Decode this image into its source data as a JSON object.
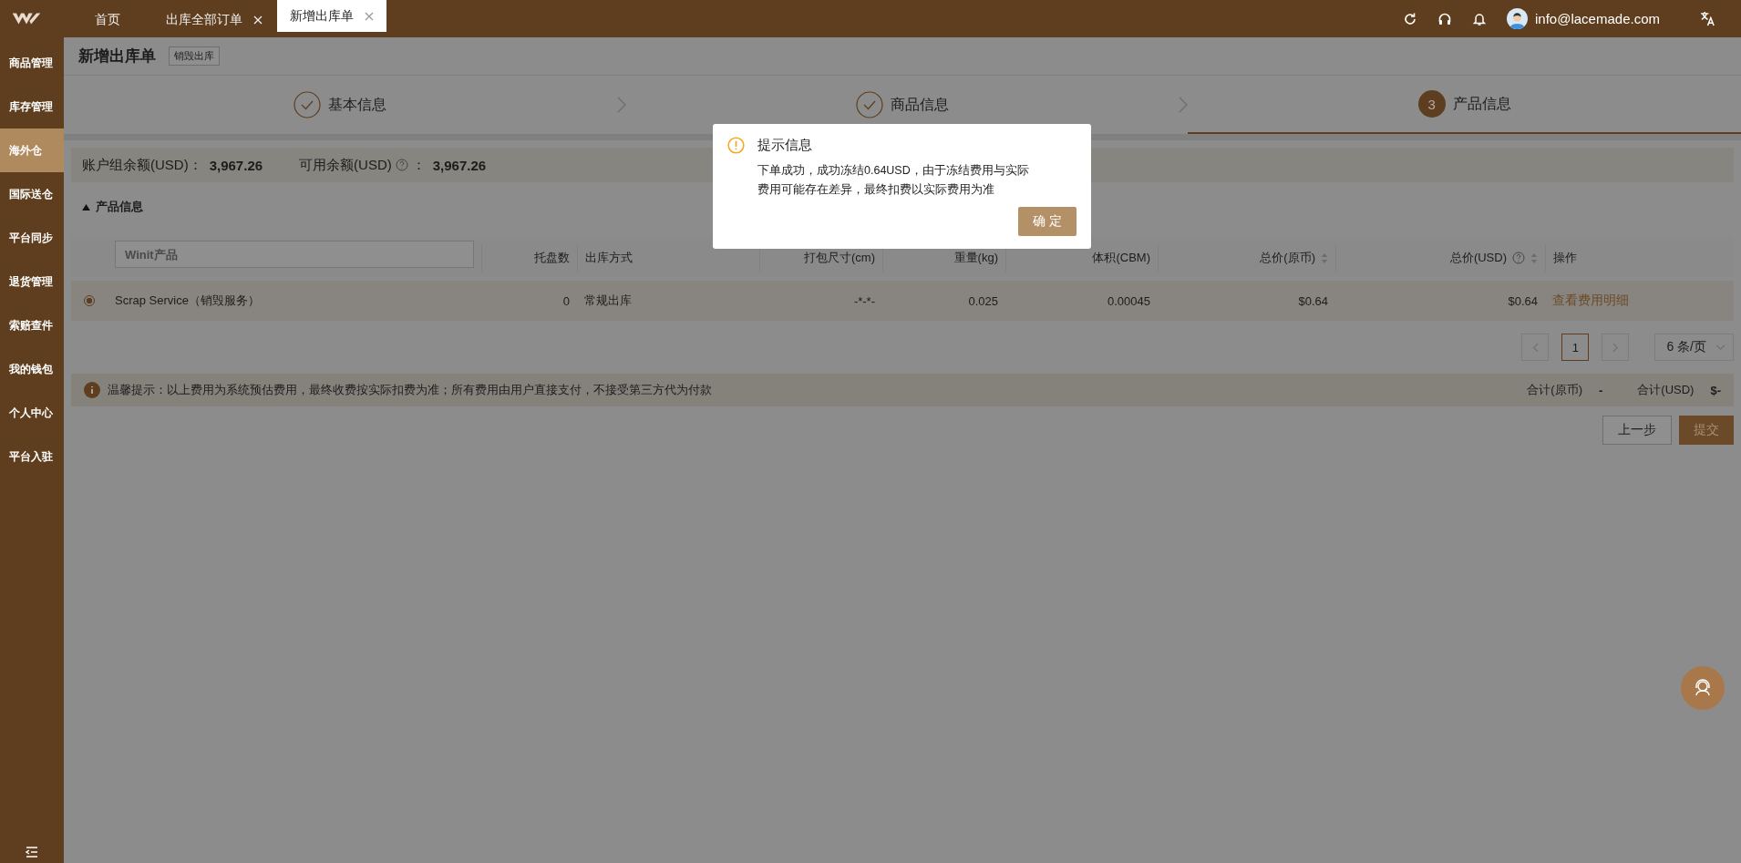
{
  "top_bar": {
    "tabs": [
      {
        "label": "首页",
        "closable": false,
        "selected": false
      },
      {
        "label": "出库全部订单",
        "closable": true,
        "selected": false
      },
      {
        "label": "新增出库单",
        "closable": true,
        "selected": true
      }
    ],
    "user_email": "info@lacemade.com"
  },
  "sidebar": {
    "items": [
      {
        "label": "商品管理",
        "selected": false
      },
      {
        "label": "库存管理",
        "selected": false
      },
      {
        "label": "海外仓",
        "selected": true
      },
      {
        "label": "国际送仓",
        "selected": false
      },
      {
        "label": "平台同步",
        "selected": false
      },
      {
        "label": "退货管理",
        "selected": false
      },
      {
        "label": "索赔查件",
        "selected": false
      },
      {
        "label": "我的钱包",
        "selected": false
      },
      {
        "label": "个人中心",
        "selected": false
      },
      {
        "label": "平台入驻",
        "selected": false
      }
    ]
  },
  "page": {
    "title": "新增出库单",
    "tag": "销毁出库"
  },
  "steps": [
    {
      "label": "基本信息",
      "done": true
    },
    {
      "label": "商品信息",
      "done": true
    },
    {
      "label": "产品信息",
      "done": false,
      "number": "3"
    }
  ],
  "balance": {
    "group_label": "账户组余额(USD)：",
    "group_value": "3,967.26",
    "available_label": "可用余额(USD)",
    "available_sep": "：",
    "available_value": "3,967.26"
  },
  "section": {
    "title": "产品信息",
    "expanded": true
  },
  "table": {
    "columns": [
      {
        "kind": "search",
        "placeholder": "Winit产品"
      },
      {
        "label": "托盘数",
        "sortable": false,
        "help": false
      },
      {
        "label": "出库方式",
        "sortable": false,
        "help": false
      },
      {
        "label": "打包尺寸(cm)",
        "sortable": false,
        "help": false
      },
      {
        "label": "重量(kg)",
        "sortable": false,
        "help": false
      },
      {
        "label": "体积(CBM)",
        "sortable": false,
        "help": false
      },
      {
        "label": "总价(原币)",
        "sortable": true,
        "help": false
      },
      {
        "label": "总价(USD)",
        "sortable": true,
        "help": true
      },
      {
        "label": "操作",
        "sortable": false,
        "help": false
      }
    ],
    "rows": [
      {
        "selected": true,
        "cells": [
          "Scrap Service（销毁服务）",
          "0",
          "常规出库",
          "-*-*-",
          "0.025",
          "0.00045",
          "$0.64",
          "$0.64",
          "查看费用明细"
        ]
      }
    ]
  },
  "pagination": {
    "current": "1",
    "page_size": "6 条/页"
  },
  "hint": {
    "text": "温馨提示：以上费用为系统预估费用，最终收费按实际扣费为准；所有费用由用户直接支付，不接受第三方代为付款",
    "total_orig_label": "合计(原币)",
    "total_orig_value": "-",
    "total_usd_label": "合计(USD)",
    "total_usd_value": "$-"
  },
  "actions": {
    "back": "上一步",
    "submit": "提交"
  },
  "dialog": {
    "title": "提示信息",
    "message": "下单成功，成功冻结0.64USD，由于冻结费用与实际费用可能存在差异，最终扣费以实际费用为准",
    "ok": "确 定"
  }
}
